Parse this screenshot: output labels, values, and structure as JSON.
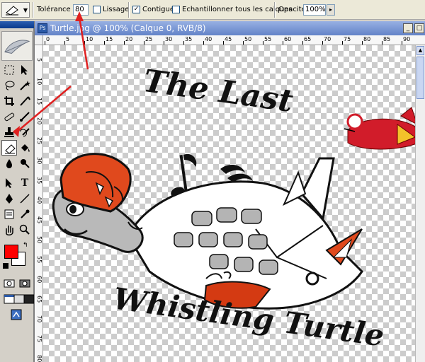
{
  "options_bar": {
    "tolerance_label": "Tolérance :",
    "tolerance_value": "80",
    "antialias_label": "Lissage",
    "contiguous_label": "Contigué",
    "contiguous_checked": "✓",
    "sample_all_label": "Echantillonner tous les calques",
    "opacity_label": "Opacité:",
    "opacity_value": "100%"
  },
  "document": {
    "title": "Turtle.jpg @ 100% (Calque 0, RVB/8)"
  },
  "ruler": {
    "h_labels": [
      "0",
      "5",
      "10",
      "15",
      "20",
      "25",
      "30",
      "35",
      "40",
      "45",
      "50",
      "55",
      "60",
      "65",
      "70",
      "75",
      "80",
      "85",
      "90"
    ],
    "v_labels": [
      "5",
      "10",
      "15",
      "20",
      "25",
      "30",
      "35",
      "40",
      "45",
      "50",
      "55",
      "60",
      "65",
      "70",
      "75",
      "80"
    ]
  },
  "artwork": {
    "top_text": "The Last",
    "bottom_text": "Whistling Turtle"
  },
  "colors": {
    "foreground": "#ff0000",
    "background": "#ffffff",
    "annotation": "#e02020",
    "helmet": "#e0491d"
  },
  "toolbox": {
    "tools": [
      "marquee-icon",
      "move-icon",
      "lasso-icon",
      "magic-wand-icon",
      "crop-icon",
      "slice-icon",
      "healing-icon",
      "brush-icon",
      "stamp-icon",
      "history-brush-icon",
      "background-eraser-icon",
      "paint-bucket-icon",
      "blur-icon",
      "dodge-icon",
      "path-select-icon",
      "type-icon",
      "pen-icon",
      "line-icon",
      "notes-icon",
      "eyedropper-icon",
      "hand-icon",
      "zoom-icon"
    ],
    "type_glyph": "T"
  }
}
